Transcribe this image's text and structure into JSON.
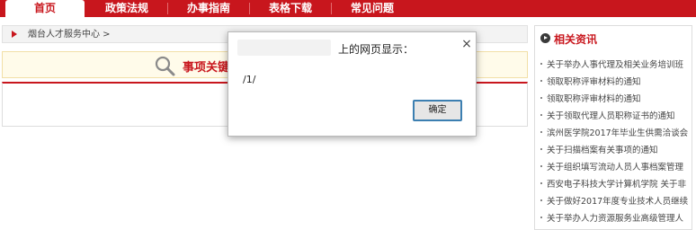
{
  "nav": {
    "tabs": [
      {
        "label": "首页",
        "active": true
      },
      {
        "label": "政策法规",
        "active": false
      },
      {
        "label": "办事指南",
        "active": false
      },
      {
        "label": "表格下载",
        "active": false
      },
      {
        "label": "常见问题",
        "active": false
      }
    ]
  },
  "breadcrumb": {
    "text": "烟台人才服务中心 >"
  },
  "search": {
    "title": "事项关键"
  },
  "sidebar": {
    "title": "相关资讯",
    "items": [
      "关于举办人事代理及相关业务培训班",
      "领取职称评审材料的通知",
      "领取职称评审材料的通知",
      "关于领取代理人员职称证书的通知",
      "滨州医学院2017年毕业生供需洽谈会",
      "关于扫描档案有关事项的通知",
      "关于组织填写流动人员人事档案管理",
      "西安电子科技大学计算机学院 关于非",
      "关于做好2017年度专业技术人员继续",
      "关于举办人力资源服务业高级管理人"
    ]
  },
  "dialog": {
    "title": "上的网页显示：",
    "message": "/1/",
    "ok_label": "确定",
    "close_symbol": "×"
  },
  "colors": {
    "brand": "#c8161d",
    "button_border": "#3c7fb1"
  }
}
